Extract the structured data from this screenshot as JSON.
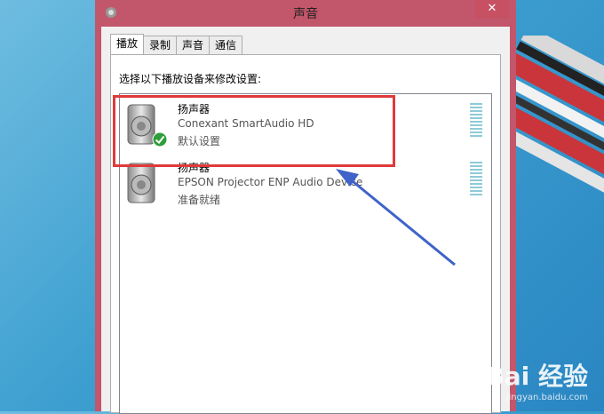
{
  "window": {
    "title": "声音",
    "close_label": "✕"
  },
  "tabs": [
    {
      "label": "播放",
      "active": true
    },
    {
      "label": "录制",
      "active": false
    },
    {
      "label": "声音",
      "active": false
    },
    {
      "label": "通信",
      "active": false
    }
  ],
  "prompt": "选择以下播放设备来修改设置:",
  "devices": [
    {
      "name": "扬声器",
      "description": "Conexant SmartAudio HD",
      "status": "默认设置",
      "icon": "speaker-icon",
      "default": true
    },
    {
      "name": "扬声器",
      "description": "EPSON Projector ENP Audio Device",
      "status": "准备就绪",
      "icon": "speaker-icon",
      "default": false
    }
  ],
  "watermark": {
    "brand": "Bai 经验",
    "url": "jingyan.baidu.com"
  },
  "colors": {
    "highlight": "#e03a3a",
    "arrow": "#3f63c8",
    "window_frame": "#c2566a"
  }
}
